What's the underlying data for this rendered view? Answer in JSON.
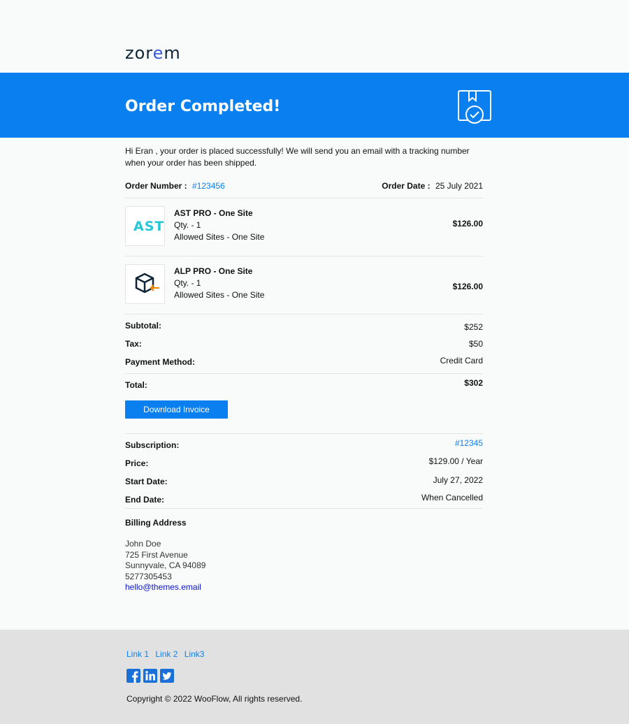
{
  "brand": {
    "logo_text_a": "zor",
    "logo_text_e": "e",
    "logo_text_b": "m"
  },
  "banner": {
    "title": "Order Completed!"
  },
  "intro": "Hi Eran , your order is placed successfully! We will send you an email with a tracking number when your order has been shipped.",
  "order": {
    "number_label": "Order Number :",
    "number_value": "#123456",
    "date_label": "Order Date :",
    "date_value": "25 July 2021"
  },
  "items": [
    {
      "name": "AST PRO - One Site",
      "qty": "Qty. - 1",
      "sites": "Allowed Sites - One Site",
      "price": "$126.00",
      "thumb_text": "AST"
    },
    {
      "name": "ALP PRO - One Site",
      "qty": "Qty. - 1",
      "sites": "Allowed Sites - One Site",
      "price": "$126.00",
      "thumb_text": ""
    }
  ],
  "totals": {
    "subtotal_label": "Subtotal:",
    "subtotal_value": "$252",
    "tax_label": "Tax:",
    "tax_value": "$50",
    "payment_label": "Payment Method:",
    "payment_value": "Credit Card",
    "total_label": "Total:",
    "total_value": "$302"
  },
  "download_button": "Download Invoice",
  "subscription": {
    "sub_label": "Subscription:",
    "sub_value": "#12345",
    "price_label": "Price:",
    "price_value": "$129.00 / Year",
    "start_label": "Start Date:",
    "start_value": "July 27, 2022",
    "end_label": "End Date:",
    "end_value": "When Cancelled"
  },
  "billing": {
    "title": "Billing Address",
    "name": "John Doe",
    "street": "725 First Avenue",
    "city": "Sunnyvale, CA 94089",
    "phone": "5277305453",
    "email": "hello@themes.email"
  },
  "footer": {
    "links": [
      "Link 1",
      "Link 2",
      "Link3"
    ],
    "social": [
      "facebook-icon",
      "linkedin-icon",
      "twitter-icon"
    ],
    "copyright": "Copyright © 2022 WooFlow, All rights reserved."
  },
  "colors": {
    "accent": "#0a80f0",
    "footer_bg": "#e1e1e1",
    "page_bg": "#f9fafa"
  }
}
